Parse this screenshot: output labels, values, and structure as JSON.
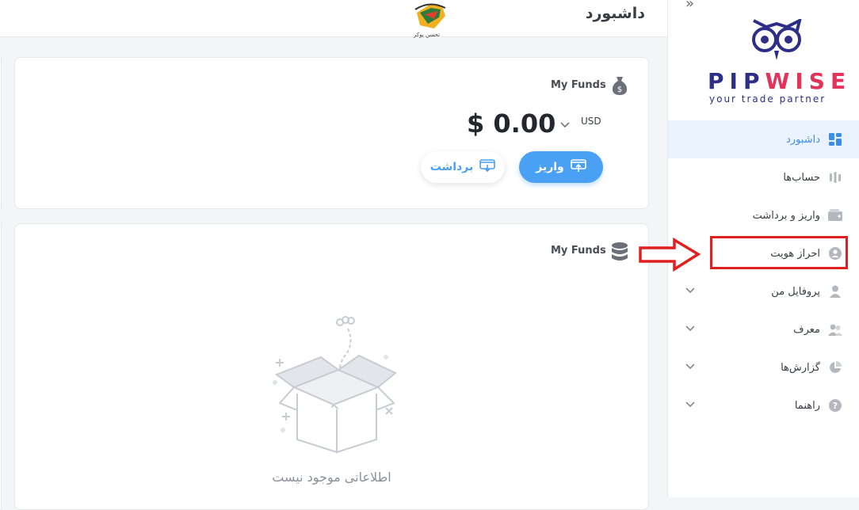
{
  "header": {
    "title": "داشبورد",
    "watermark_text": "تحسن پوکر"
  },
  "logo": {
    "name_part1": "PIP",
    "name_part2": "WISE",
    "tagline": "your trade partner"
  },
  "sidebar": {
    "items": [
      {
        "label": "داشبورد",
        "icon": "dashboard-icon",
        "active": true
      },
      {
        "label": "حساب‌ها",
        "icon": "accounts-icon"
      },
      {
        "label": "واریز و برداشت",
        "icon": "wallet-icon"
      },
      {
        "label": "احراز هویت",
        "icon": "user-circle-icon"
      },
      {
        "label": "پروفایل من",
        "icon": "person-icon",
        "has_children": true
      },
      {
        "label": "معرف",
        "icon": "users-icon",
        "has_children": true
      },
      {
        "label": "گزارش‌ها",
        "icon": "pie-chart-icon",
        "has_children": true
      },
      {
        "label": "راهنما",
        "icon": "help-icon",
        "has_children": true
      }
    ]
  },
  "funds_card": {
    "title": "My Funds",
    "amount": "$ 0.00",
    "currency": "USD",
    "deposit_label": "واریز",
    "withdraw_label": "برداشت"
  },
  "funds_list_card": {
    "title": "My Funds",
    "empty_text": "اطلاعاتی موجود نیست"
  },
  "colors": {
    "accent": "#4aa0f2",
    "active_bg": "#eaf3fd",
    "brand": "#2d2f86",
    "highlight": "#e02020"
  }
}
